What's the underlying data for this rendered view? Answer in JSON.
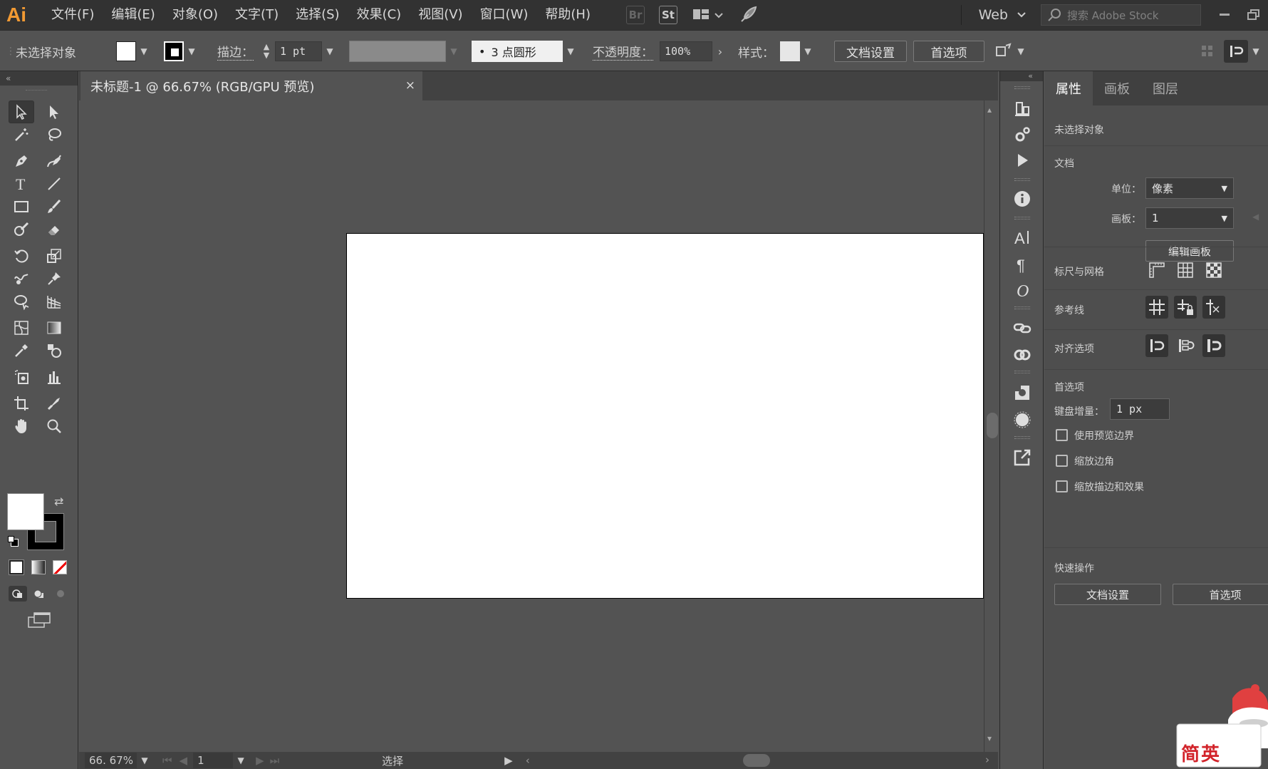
{
  "app": {
    "logo": "Ai"
  },
  "menubar": {
    "items": [
      "文件(F)",
      "编辑(E)",
      "对象(O)",
      "文字(T)",
      "选择(S)",
      "效果(C)",
      "视图(V)",
      "窗口(W)",
      "帮助(H)"
    ],
    "bridge": "Br",
    "stock": "St",
    "workspace": "Web",
    "search_placeholder": "搜索 Adobe Stock"
  },
  "control": {
    "selection": "未选择对象",
    "stroke_label": "描边：",
    "stroke_weight": "1 pt",
    "brush": "3 点圆形",
    "opacity_label": "不透明度：",
    "opacity": "100%",
    "style_label": "样式：",
    "doc_setup": "文档设置",
    "preferences": "首选项"
  },
  "document": {
    "tab_title": "未标题-1 @ 66.67% (RGB/GPU 预览)",
    "close": "×"
  },
  "status": {
    "zoom": "66. 67%",
    "artboard": "1",
    "mode": "选择"
  },
  "panel": {
    "tabs": [
      "属性",
      "画板",
      "图层"
    ],
    "active_tab": "属性",
    "no_selection": "未选择对象",
    "doc_heading": "文档",
    "units_label": "单位：",
    "units": "像素",
    "artboard_label": "画板：",
    "artboard": "1",
    "edit_artboards": "编辑画板",
    "rulers_grids": "标尺与网格",
    "guides": "参考线",
    "align_options": "对齐选项",
    "prefs_heading": "首选项",
    "keyboard_inc_label": "键盘增量：",
    "keyboard_inc": "1 px",
    "use_preview_bounds": "使用预览边界",
    "scale_corners": "缩放边角",
    "scale_strokes": "缩放描边和效果",
    "quick_actions": "快速操作",
    "doc_setup": "文档设置",
    "preferences": "首选项"
  },
  "sticker": {
    "text": "简英"
  },
  "colors": {
    "accent_orange": "#f29a33",
    "bg": "#535353",
    "bar": "#323232"
  }
}
